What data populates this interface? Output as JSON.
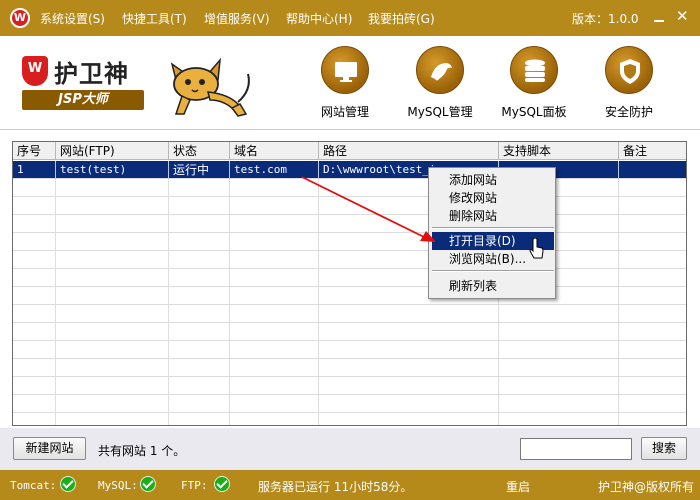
{
  "menubar": {
    "items": [
      "系统设置(S)",
      "快捷工具(T)",
      "增值服务(V)",
      "帮助中心(H)",
      "我要拍砖(G)"
    ],
    "version": "版本：1.0.0",
    "accent_color": "#b58a1a"
  },
  "header": {
    "logo_title": "护卫神",
    "logo_sub": "JSP大师",
    "buttons": [
      {
        "label": "网站管理",
        "icon": "monitor-icon"
      },
      {
        "label": "MySQL管理",
        "icon": "dolphin-icon"
      },
      {
        "label": "MySQL面板",
        "icon": "database-icon"
      },
      {
        "label": "安全防护",
        "icon": "shield-icon"
      }
    ]
  },
  "table": {
    "columns": [
      "序号",
      "网站(FTP)",
      "状态",
      "域名",
      "路径",
      "支持脚本",
      "备注"
    ],
    "rows": [
      [
        "1",
        "test(test)",
        "运行中",
        "test.com",
        "D:\\wwwroot\\test_i",
        "",
        ""
      ]
    ]
  },
  "context_menu": {
    "items": [
      "添加网站",
      "修改网站",
      "删除网站",
      "打开目录(D)",
      "浏览网站(B)...",
      "刷新列表"
    ],
    "highlighted": "打开目录(D)"
  },
  "bottom": {
    "new_site_label": "新建网站",
    "site_count_text": "共有网站 1 个。",
    "search_value": "",
    "search_label": "搜索"
  },
  "status": {
    "tomcat_label": "Tomcat:",
    "mysql_label": "MySQL:",
    "ftp_label": "FTP:",
    "uptime": "服务器已运行 11小时58分。",
    "restart_label": "重启",
    "copyright": "护卫神@版权所有"
  }
}
